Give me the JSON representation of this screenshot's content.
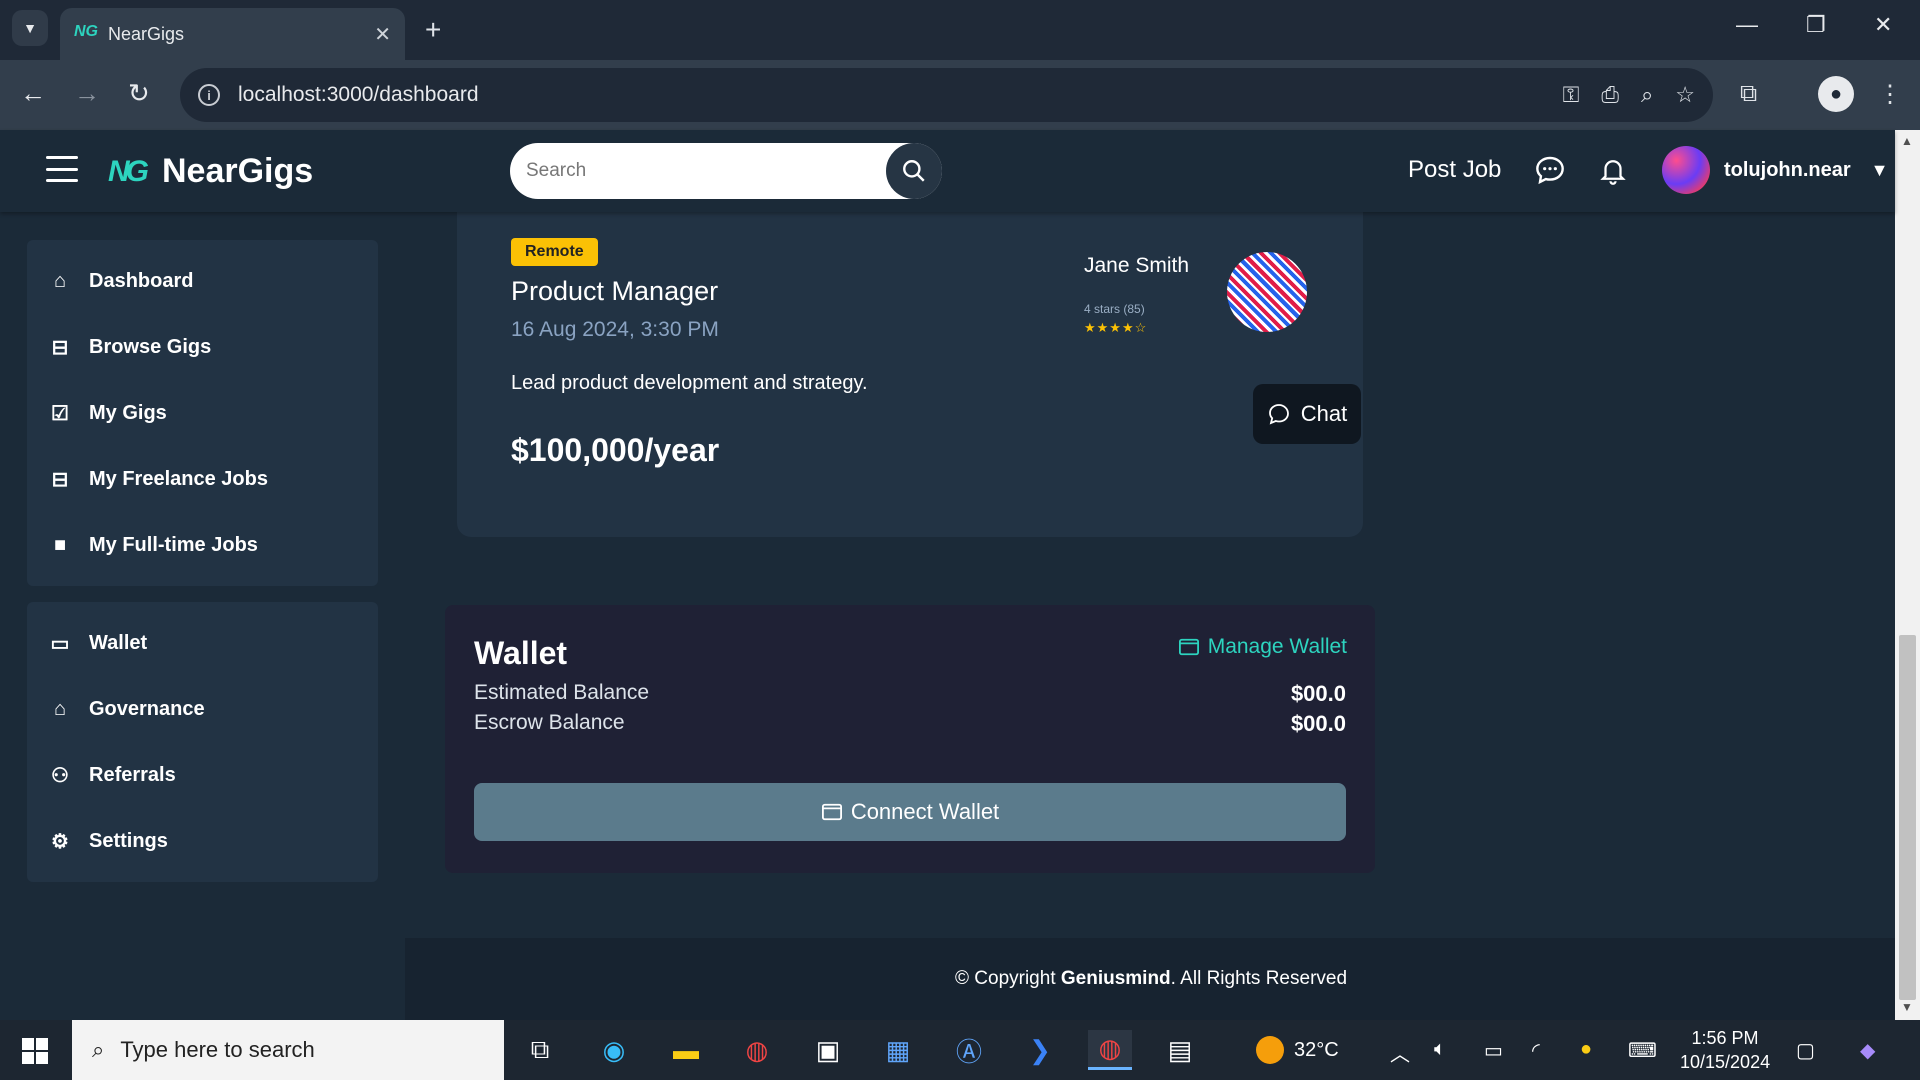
{
  "browser": {
    "tab_title": "NearGigs",
    "url": "localhost:3000/dashboard"
  },
  "header": {
    "brand": "NearGigs",
    "logo_mark": "NG",
    "search_placeholder": "Search",
    "post_job": "Post Job",
    "username": "tolujohn.near"
  },
  "sidebar": {
    "primary": [
      {
        "label": "Dashboard",
        "icon": "home-icon"
      },
      {
        "label": "Browse Gigs",
        "icon": "briefcase-icon"
      },
      {
        "label": "My Gigs",
        "icon": "clipboard-check-icon"
      },
      {
        "label": "My Freelance Jobs",
        "icon": "briefcase-icon"
      },
      {
        "label": "My Full-time Jobs",
        "icon": "briefcase-filled-icon"
      }
    ],
    "secondary": [
      {
        "label": "Wallet",
        "icon": "wallet-icon"
      },
      {
        "label": "Governance",
        "icon": "bank-icon"
      },
      {
        "label": "Referrals",
        "icon": "people-icon"
      },
      {
        "label": "Settings",
        "icon": "gear-icon"
      }
    ]
  },
  "job": {
    "badge": "Remote",
    "title": "Product Manager",
    "date": "16 Aug 2024, 3:30 PM",
    "description": "Lead product development and strategy.",
    "salary": "$100,000/year",
    "poster_name": "Jane Smith",
    "rating_text": "4 stars (85)",
    "stars": "★★★★☆",
    "rating_value": 4,
    "chat_label": "Chat"
  },
  "wallet": {
    "title": "Wallet",
    "manage_label": "Manage Wallet",
    "estimated_label": "Estimated Balance",
    "estimated_value": "$00.0",
    "escrow_label": "Escrow Balance",
    "escrow_value": "$00.0",
    "connect_label": "Connect Wallet"
  },
  "footer": {
    "prefix": "© Copyright ",
    "company": "Geniusmind",
    "suffix": ". All Rights Reserved"
  },
  "taskbar": {
    "search_placeholder": "Type here to search",
    "temperature": "32°C",
    "time": "1:56 PM",
    "date": "10/15/2024"
  },
  "colors": {
    "accent": "#2dd4bf",
    "badge": "#fbc105",
    "background": "#1b2a38",
    "card": "#223344"
  }
}
